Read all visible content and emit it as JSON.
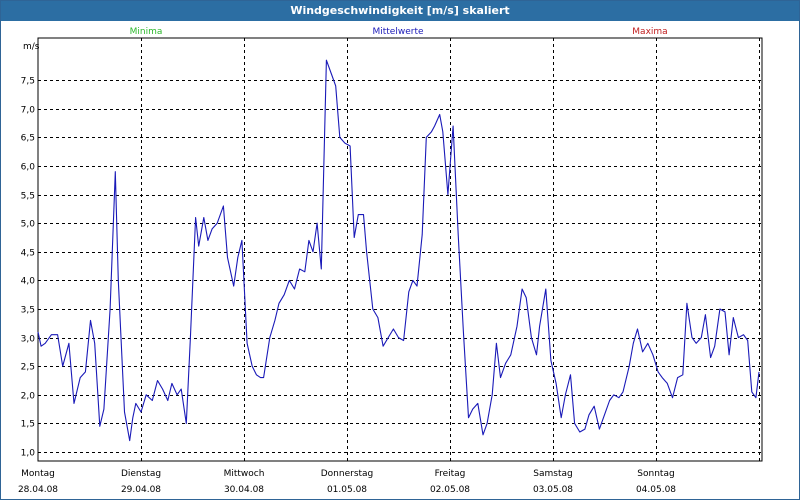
{
  "window": {
    "title": "Windgeschwindigkeit [m/s] skaliert"
  },
  "colors": {
    "minima": "#2db82d",
    "mittel": "#1a1ab8",
    "maxima": "#c02020",
    "line": "#1a1ab8",
    "grid": "#000000"
  },
  "chart_data": {
    "type": "line",
    "title": "Windgeschwindigkeit [m/s] skaliert",
    "ylabel": "m/s",
    "ylim": [
      1.0,
      8.0
    ],
    "yticks": [
      1.0,
      1.5,
      2.0,
      2.5,
      3.0,
      3.5,
      4.0,
      4.5,
      5.0,
      5.5,
      6.0,
      6.5,
      7.0,
      7.5
    ],
    "xlim": [
      0,
      7
    ],
    "grid": true,
    "legend": [
      "Minima",
      "Mittelwerte",
      "Maxima"
    ],
    "x_labels": [
      {
        "day": "Montag",
        "date": "28.04.08"
      },
      {
        "day": "Dienstag",
        "date": "29.04.08"
      },
      {
        "day": "Mittwoch",
        "date": "30.04.08"
      },
      {
        "day": "Donnerstag",
        "date": "01.05.08"
      },
      {
        "day": "Freitag",
        "date": "02.05.08"
      },
      {
        "day": "Samstag",
        "date": "03.05.08"
      },
      {
        "day": "Sonntag",
        "date": "04.05.08"
      }
    ],
    "series": [
      {
        "name": "Mittelwerte",
        "x": [
          0.0,
          0.03,
          0.07,
          0.13,
          0.19,
          0.24,
          0.3,
          0.35,
          0.41,
          0.46,
          0.51,
          0.55,
          0.6,
          0.64,
          0.7,
          0.75,
          0.78,
          0.84,
          0.89,
          0.92,
          0.95,
          1.0,
          1.05,
          1.11,
          1.16,
          1.21,
          1.26,
          1.3,
          1.35,
          1.39,
          1.44,
          1.48,
          1.53,
          1.56,
          1.61,
          1.65,
          1.69,
          1.74,
          1.8,
          1.84,
          1.9,
          1.94,
          1.98,
          2.03,
          2.08,
          2.12,
          2.16,
          2.19,
          2.25,
          2.3,
          2.34,
          2.39,
          2.44,
          2.49,
          2.54,
          2.59,
          2.63,
          2.67,
          2.71,
          2.75,
          2.8,
          2.85,
          2.89,
          2.93,
          2.98,
          3.03,
          3.07,
          3.11,
          3.16,
          3.19,
          3.25,
          3.3,
          3.35,
          3.4,
          3.45,
          3.5,
          3.55,
          3.6,
          3.64,
          3.68,
          3.73,
          3.77,
          3.82,
          3.85,
          3.9,
          3.93,
          3.98,
          4.03,
          4.08,
          4.13,
          4.18,
          4.22,
          4.27,
          4.32,
          4.36,
          4.41,
          4.45,
          4.49,
          4.54,
          4.59,
          4.65,
          4.7,
          4.74,
          4.79,
          4.84,
          4.87,
          4.93,
          4.98,
          5.03,
          5.08,
          5.12,
          5.17,
          5.21,
          5.26,
          5.31,
          5.35,
          5.4,
          5.45,
          5.5,
          5.55,
          5.59,
          5.64,
          5.68,
          5.74,
          5.78,
          5.82,
          5.87,
          5.92,
          5.97,
          6.02,
          6.06,
          6.11,
          6.16,
          6.21,
          6.26,
          6.3,
          6.35,
          6.39,
          6.44,
          6.48,
          6.53,
          6.57,
          6.62,
          6.67,
          6.71,
          6.75,
          6.8,
          6.85,
          6.89,
          6.93,
          6.97,
          7.0
        ],
        "values": [
          3.1,
          2.85,
          2.9,
          3.05,
          3.05,
          2.5,
          2.9,
          1.85,
          2.3,
          2.4,
          3.3,
          2.9,
          1.45,
          1.75,
          3.5,
          5.9,
          4.0,
          1.7,
          1.2,
          1.6,
          1.85,
          1.7,
          2.0,
          1.9,
          2.25,
          2.1,
          1.9,
          2.2,
          2.0,
          2.1,
          1.5,
          3.0,
          5.1,
          4.6,
          5.1,
          4.7,
          4.9,
          5.0,
          5.3,
          4.4,
          3.9,
          4.4,
          4.7,
          2.9,
          2.5,
          2.35,
          2.3,
          2.3,
          3.0,
          3.3,
          3.6,
          3.75,
          4.0,
          3.85,
          4.2,
          4.15,
          4.7,
          4.5,
          5.0,
          4.2,
          7.85,
          7.6,
          7.4,
          6.5,
          6.4,
          6.35,
          4.75,
          5.15,
          5.15,
          4.5,
          3.5,
          3.35,
          2.85,
          3.0,
          3.15,
          3.0,
          2.95,
          3.8,
          4.0,
          3.9,
          4.8,
          6.5,
          6.6,
          6.7,
          6.9,
          6.6,
          5.5,
          6.7,
          4.8,
          3.1,
          1.6,
          1.75,
          1.85,
          1.3,
          1.5,
          2.0,
          2.9,
          2.3,
          2.55,
          2.7,
          3.2,
          3.85,
          3.7,
          3.0,
          2.7,
          3.2,
          3.85,
          2.6,
          2.2,
          1.6,
          2.0,
          2.35,
          1.5,
          1.35,
          1.4,
          1.65,
          1.8,
          1.4,
          1.65,
          1.9,
          2.0,
          1.95,
          2.05,
          2.5,
          2.9,
          3.15,
          2.75,
          2.9,
          2.7,
          2.4,
          2.3,
          2.2,
          1.95,
          2.3,
          2.35,
          3.6,
          3.0,
          2.9,
          3.0,
          3.4,
          2.65,
          2.85,
          3.5,
          3.45,
          2.7,
          3.35,
          3.0,
          3.05,
          2.95,
          2.05,
          1.95,
          2.4
        ]
      }
    ]
  }
}
